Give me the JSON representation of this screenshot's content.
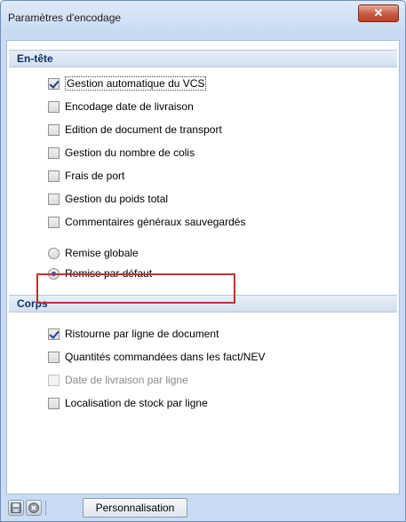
{
  "window": {
    "title": "Paramètres d'encodage",
    "close_glyph": "✕"
  },
  "sections": {
    "entete": {
      "header": "En-tête",
      "checkboxes": [
        {
          "label": "Gestion automatique du VCS",
          "checked": true
        },
        {
          "label": "Encodage date de livraison",
          "checked": false
        },
        {
          "label": "Edition de document de transport",
          "checked": false
        },
        {
          "label": "Gestion du nombre de colis",
          "checked": false
        },
        {
          "label": "Frais de port",
          "checked": false
        },
        {
          "label": "Gestion du poids total",
          "checked": false
        },
        {
          "label": "Commentaires généraux sauvegardés",
          "checked": false
        }
      ],
      "radios": [
        {
          "label": "Remise globale",
          "selected": false
        },
        {
          "label": "Remise par défaut",
          "selected": true
        }
      ]
    },
    "corps": {
      "header": "Corps",
      "checkboxes": [
        {
          "label": "Ristourne par ligne de document",
          "checked": true
        },
        {
          "label": "Quantités commandées dans les fact/NEV",
          "checked": false
        },
        {
          "label": "Date de livraison par ligne",
          "checked": false,
          "disabled": true
        },
        {
          "label": "Localisation de stock par ligne",
          "checked": false
        }
      ]
    }
  },
  "toolbar": {
    "icons": [
      "save-icon",
      "close-circle-icon"
    ],
    "personnalisation_label": "Personnalisation"
  },
  "colors": {
    "highlight": "#c23030",
    "title_gradient": "#dfeafa",
    "close_button": "#c65a44"
  }
}
